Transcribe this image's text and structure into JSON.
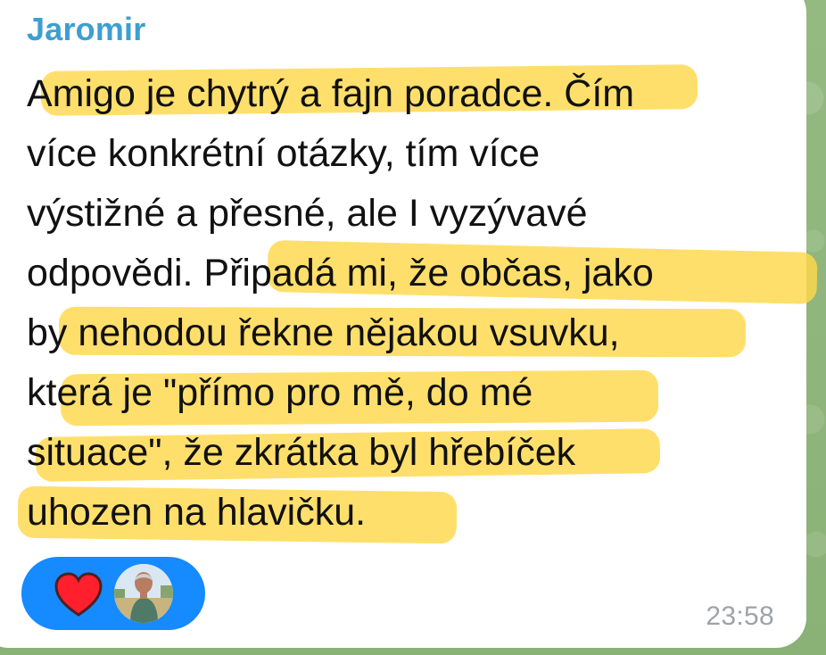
{
  "message": {
    "sender": "Jaromir",
    "lines": [
      "Amigo je chytrý a fajn poradce. Čím",
      "více konkrétní otázky, tím více",
      "výstižné a přesné, ale I vyzývavé",
      "odpovědi. Připadá mi, že občas, jako",
      "by nehodou řekne nějakou vsuvku,",
      "která je \"přímo pro mě, do mé",
      "situace\", že zkrátka byl hřebíček",
      "uhozen na hlavičku."
    ],
    "time": "23:58"
  },
  "reaction": {
    "emoji_icon": "heart-icon",
    "avatar_icon": "user-avatar",
    "color": "#168aff"
  },
  "highlight_color": "#ffd84a"
}
